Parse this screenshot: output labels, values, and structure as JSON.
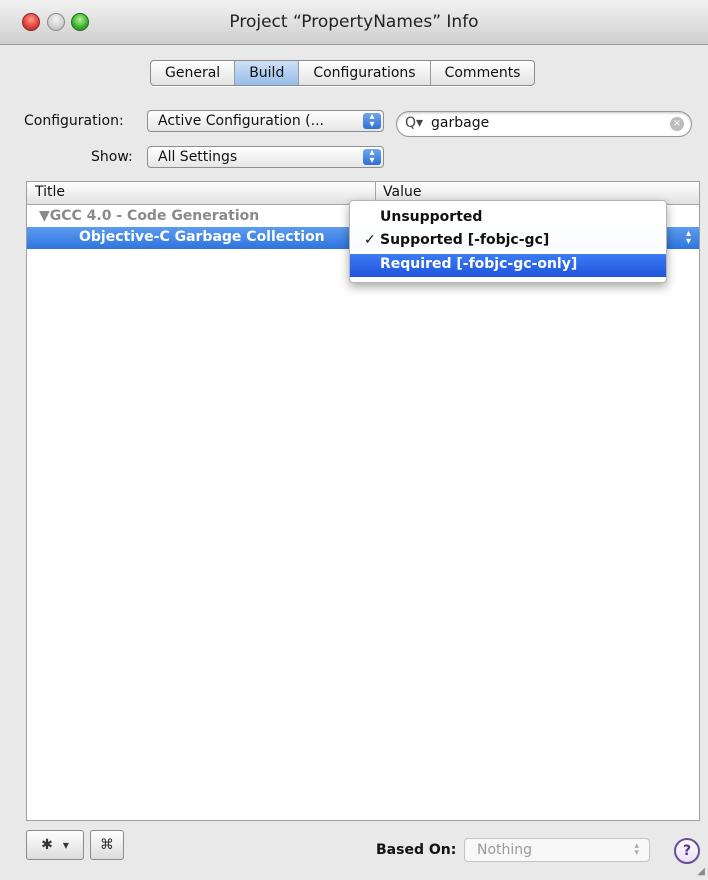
{
  "window": {
    "title": "Project “PropertyNames” Info"
  },
  "tabs": [
    "General",
    "Build",
    "Configurations",
    "Comments"
  ],
  "active_tab": "Build",
  "configuration": {
    "label": "Configuration:",
    "value": "Active Configuration (..."
  },
  "show": {
    "label": "Show:",
    "value": "All Settings"
  },
  "search": {
    "value": "garbage"
  },
  "table": {
    "headers": [
      "Title",
      "Value"
    ],
    "group": "▼GCC 4.0 - Code Generation",
    "selected_row_title": "Objective-C Garbage Collection"
  },
  "dropdown": {
    "items": [
      "Unsupported",
      "Supported [-fobjc-gc]",
      "Required [-fobjc-gc-only]"
    ],
    "checked_index": 1,
    "highlighted_index": 2,
    "check_glyph": "✓"
  },
  "bottom": {
    "gear_icon": "✱",
    "gear_dropdown": "▾",
    "info_icon": "⌘",
    "based_on_label": "Based On:",
    "based_on_value": "Nothing",
    "help": "?"
  },
  "colors": {
    "selection": "#2f74de",
    "menu_highlight": "#1f54dd",
    "active_tab": "#95bde9"
  }
}
